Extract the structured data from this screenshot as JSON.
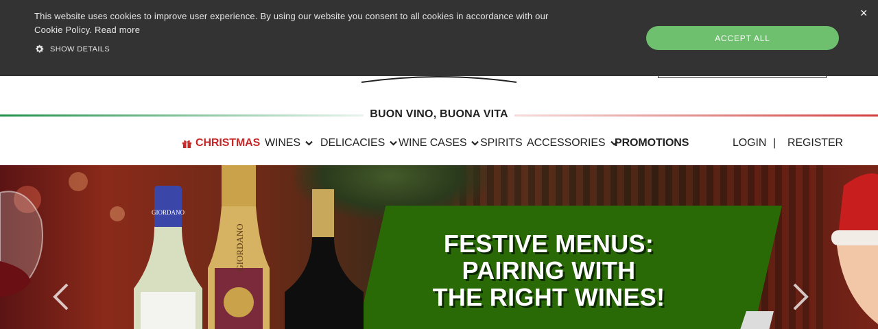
{
  "cookie_banner": {
    "text": "This website uses cookies to improve user experience. By using our website you consent to all cookies in accordance with our Cookie Policy.",
    "read_more": "Read more",
    "show_details": "SHOW DETAILS",
    "accept_all": "ACCEPT ALL",
    "close": "×",
    "accent_color": "#6ebf6e"
  },
  "tagline": "BUON VINO, BUONA VITA",
  "nav": {
    "items": [
      {
        "label": "CHRISTMAS",
        "icon": "gift-icon",
        "has_dropdown": false
      },
      {
        "label": "WINES",
        "has_dropdown": true
      },
      {
        "label": "DELICACIES",
        "has_dropdown": true
      },
      {
        "label": "WINE CASES",
        "has_dropdown": true
      },
      {
        "label": "SPIRITS",
        "has_dropdown": false
      },
      {
        "label": "ACCESSORIES",
        "has_dropdown": true
      },
      {
        "label": "PROMOTIONS",
        "has_dropdown": false
      }
    ],
    "login": "LOGIN",
    "separator": "|",
    "register": "REGISTER",
    "christmas_color": "#c62828"
  },
  "hero": {
    "title_line1": "FESTIVE MENUS:",
    "title_line2": "PAIRING WITH",
    "title_line3": "THE RIGHT WINES!",
    "brand_on_bottles": "GIORDANO",
    "panel_color": "#2a6a06"
  }
}
